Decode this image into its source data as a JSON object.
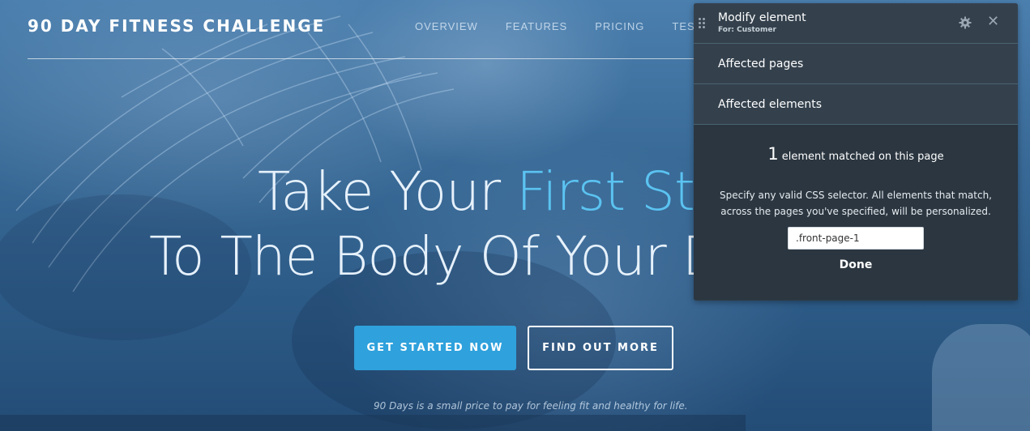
{
  "site": {
    "brand": "90 DAY FITNESS CHALLENGE",
    "nav": [
      "OVERVIEW",
      "FEATURES",
      "PRICING",
      "TESTIMO"
    ],
    "headline": {
      "line1_plain": "Take Your ",
      "line1_accent": "First St",
      "line2": "To The Body Of Your D"
    },
    "buttons": {
      "primary": "GET STARTED NOW",
      "secondary": "FIND OUT MORE"
    },
    "tagline": "90 Days is a small price to pay for feeling fit and healthy for life."
  },
  "panel": {
    "title": "Modify element",
    "subtitle": "For: Customer",
    "sections": [
      "Affected pages",
      "Affected elements"
    ],
    "match_count": "1",
    "match_text": "element matched on this page",
    "instructions_line1": "Specify any valid CSS selector. All elements that match,",
    "instructions_line2": "across the pages you've specified, will be personalized.",
    "selector_value": ".front-page-1",
    "done_label": "Done"
  },
  "colors": {
    "accent": "#5bc3f1",
    "primary_button": "#2fa1dc",
    "panel_bg": "#2f3b45"
  }
}
